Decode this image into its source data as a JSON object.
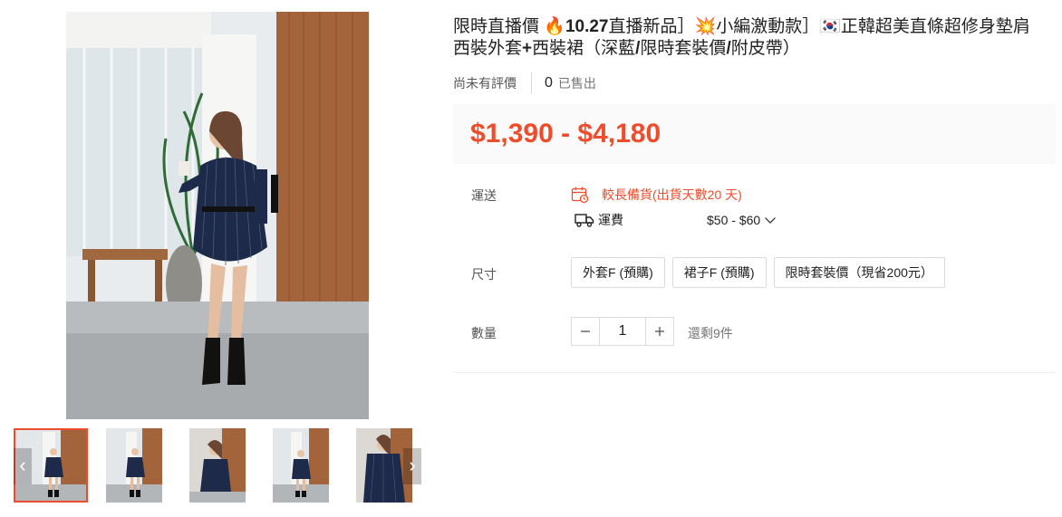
{
  "product": {
    "title_parts": {
      "p1": "限時直播價 ",
      "fire_emoji": "🔥",
      "p2": "10.27",
      "p3": "直播新品］",
      "boom_emoji": "💥",
      "p4": "小編激動款］",
      "flag_emoji": "🇰🇷",
      "p5": "正韓超美直條超修身墊肩",
      "p6": "西裝外套",
      "p7": "+",
      "p8": "西裝裙（深藍",
      "p9": "/",
      "p10": "限時套裝價",
      "p11": "/",
      "p12": "附皮帶）"
    },
    "reviews_text": "尚未有評價",
    "sold_count": "0",
    "sold_label": "已售出",
    "price": "$1,390 - $4,180"
  },
  "shipping": {
    "label": "運送",
    "warning": "較長備貨(出貨天數20 天)",
    "fee_label": "運費",
    "fee_value": "$50 - $60"
  },
  "size": {
    "label": "尺寸",
    "options": [
      "外套F (預購)",
      "裙子F (預購)",
      "限時套裝價（現省200元）"
    ]
  },
  "quantity": {
    "label": "數量",
    "value": "1",
    "stock": "還剩9件"
  },
  "colors": {
    "accent": "#ee4d2d",
    "price_bg": "#fafafa",
    "border": "#dcdcdc"
  },
  "icons": {
    "prev": "chevron-left-icon",
    "next": "chevron-right-icon",
    "calendar": "calendar-clock-icon",
    "truck": "truck-icon",
    "dropdown": "chevron-down-icon",
    "minus": "minus-icon",
    "plus": "plus-icon"
  },
  "gallery": {
    "thumbnail_count": 5,
    "active_index": 0
  }
}
